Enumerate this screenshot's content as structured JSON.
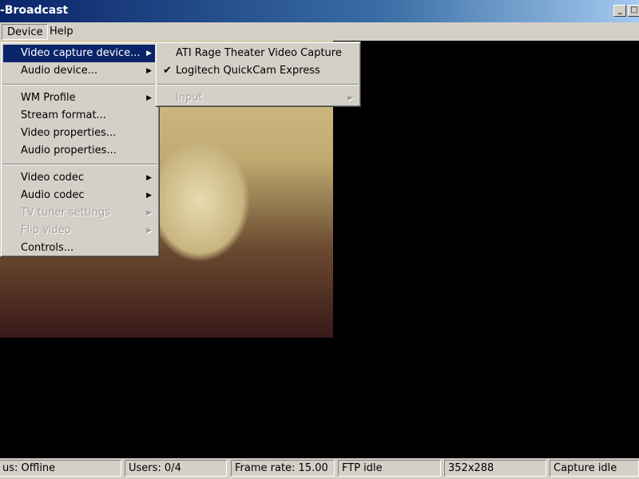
{
  "window": {
    "title": "-Broadcast"
  },
  "menubar": [
    {
      "label": "Device"
    },
    {
      "label": "Help"
    }
  ],
  "device_menu": [
    {
      "label": "Video capture device...",
      "arrow": true
    },
    {
      "label": "Audio device...",
      "arrow": true
    },
    {
      "label": "WM Profile",
      "arrow": true
    },
    {
      "label": "Stream format..."
    },
    {
      "label": "Video properties..."
    },
    {
      "label": "Audio properties..."
    },
    {
      "label": "Video codec",
      "arrow": true
    },
    {
      "label": "Audio codec",
      "arrow": true
    },
    {
      "label": "TV tuner settings",
      "arrow": true,
      "disabled": true
    },
    {
      "label": "Flip video",
      "arrow": true,
      "disabled": true
    },
    {
      "label": "Controls..."
    }
  ],
  "submenu": [
    {
      "label": "ATI Rage Theater Video Capture"
    },
    {
      "label": "Logitech QuickCam Express",
      "checked": true
    },
    {
      "label": "Input",
      "disabled": true
    }
  ],
  "status": [
    "us: Offline",
    "Users: 0/4",
    "Frame rate: 15.00",
    "FTP idle",
    "352x288",
    "Capture idle"
  ]
}
